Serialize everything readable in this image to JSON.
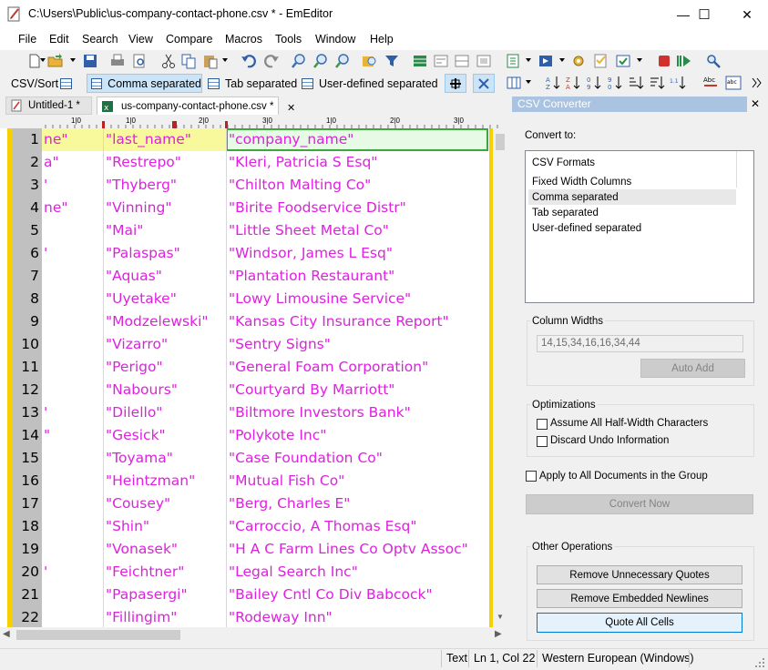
{
  "window": {
    "title": "C:\\Users\\Public\\us-company-contact-phone.csv * - EmEditor",
    "minimize": "—",
    "maximize": "☐",
    "close": "✕"
  },
  "menu": [
    "File",
    "Edit",
    "Search",
    "View",
    "Compare",
    "Macros",
    "Tools",
    "Window",
    "Help"
  ],
  "csv_toolbar": {
    "csv_sort": "CSV/Sort",
    "comma": "Comma separated",
    "tab": "Tab separated",
    "user": "User-defined separated",
    "active": "Comma separated"
  },
  "tabs": [
    {
      "label": "Untitled-1 *"
    },
    {
      "label": "us-company-contact-phone.csv *"
    }
  ],
  "ruler": {
    "marks": [
      "1|0",
      "1|0",
      "2|0",
      "3|0",
      "1|0",
      "2|0",
      "3|0"
    ]
  },
  "grid": {
    "rows": [
      {
        "n": "1",
        "c1": "ne\"",
        "c2": "\"last_name\"",
        "c3": "\"company_name\""
      },
      {
        "n": "2",
        "c1": "a\"",
        "c2": "\"Restrepo\"",
        "c3": "\"Kleri, Patricia S Esq\""
      },
      {
        "n": "3",
        "c1": "'",
        "c2": "\"Thyberg\"",
        "c3": "\"Chilton Malting Co\""
      },
      {
        "n": "4",
        "c1": "ne\"",
        "c2": "\"Vinning\"",
        "c3": "\"Birite Foodservice Distr\""
      },
      {
        "n": "5",
        "c1": "",
        "c2": "\"Mai\"",
        "c3": "\"Little Sheet Metal Co\""
      },
      {
        "n": "6",
        "c1": "'",
        "c2": "\"Palaspas\"",
        "c3": "\"Windsor, James L Esq\""
      },
      {
        "n": "7",
        "c1": "",
        "c2": "\"Aquas\"",
        "c3": "\"Plantation Restaurant\""
      },
      {
        "n": "8",
        "c1": "",
        "c2": "\"Uyetake\"",
        "c3": "\"Lowy Limousine Service\""
      },
      {
        "n": "9",
        "c1": "",
        "c2": "\"Modzelewski\"",
        "c3": "\"Kansas City Insurance Report\""
      },
      {
        "n": "10",
        "c1": "",
        "c2": "\"Vizarro\"",
        "c3": "\"Sentry Signs\""
      },
      {
        "n": "11",
        "c1": "",
        "c2": "\"Perigo\"",
        "c3": "\"General Foam Corporation\""
      },
      {
        "n": "12",
        "c1": "",
        "c2": "\"Nabours\"",
        "c3": "\"Courtyard By Marriott\""
      },
      {
        "n": "13",
        "c1": "'",
        "c2": "\"Dilello\"",
        "c3": "\"Biltmore Investors Bank\""
      },
      {
        "n": "14",
        "c1": "\"",
        "c2": "\"Gesick\"",
        "c3": "\"Polykote Inc\""
      },
      {
        "n": "15",
        "c1": "",
        "c2": "\"Toyama\"",
        "c3": "\"Case Foundation Co\""
      },
      {
        "n": "16",
        "c1": "",
        "c2": "\"Heintzman\"",
        "c3": "\"Mutual Fish Co\""
      },
      {
        "n": "17",
        "c1": "",
        "c2": "\"Cousey\"",
        "c3": "\"Berg, Charles E\""
      },
      {
        "n": "18",
        "c1": "",
        "c2": "\"Shin\"",
        "c3": "\"Carroccio, A Thomas Esq\""
      },
      {
        "n": "19",
        "c1": "",
        "c2": "\"Vonasek\"",
        "c3": "\"H A C Farm Lines Co Optv Assoc\""
      },
      {
        "n": "20",
        "c1": "'",
        "c2": "\"Feichtner\"",
        "c3": "\"Legal Search Inc\""
      },
      {
        "n": "21",
        "c1": "",
        "c2": "\"Papasergi\"",
        "c3": "\"Bailey Cntl Co Div Babcock\""
      },
      {
        "n": "22",
        "c1": "",
        "c2": "\"Fillingim\"",
        "c3": "\"Rodeway Inn\""
      }
    ]
  },
  "panel": {
    "title": "CSV Converter",
    "close": "✕",
    "convert_to": "Convert to:",
    "formats": [
      "CSV Formats",
      "Fixed Width Columns",
      "Comma separated",
      "Tab separated",
      "User-defined separated"
    ],
    "selected_format": "Comma separated",
    "column_widths_label": "Column Widths",
    "column_widths_value": "14,15,34,16,16,34,44",
    "auto_add": "Auto Add",
    "optimizations_label": "Optimizations",
    "opt1": "Assume All Half-Width Characters",
    "opt2": "Discard Undo Information",
    "apply_all": "Apply to All Documents in the Group",
    "convert_now": "Convert Now",
    "other_ops_label": "Other Operations",
    "btn_remove_quotes": "Remove Unnecessary Quotes",
    "btn_remove_newlines": "Remove Embedded Newlines",
    "btn_quote_all": "Quote All Cells"
  },
  "status": {
    "mode": "Text",
    "position": "Ln 1, Col 22",
    "encoding": "Western European (Windows)"
  },
  "colors": {
    "cell_text": "#e020e0",
    "highlight": "#f8f89c",
    "active_cell_border": "#3ca83c",
    "yellow_bar": "#f6d000"
  }
}
